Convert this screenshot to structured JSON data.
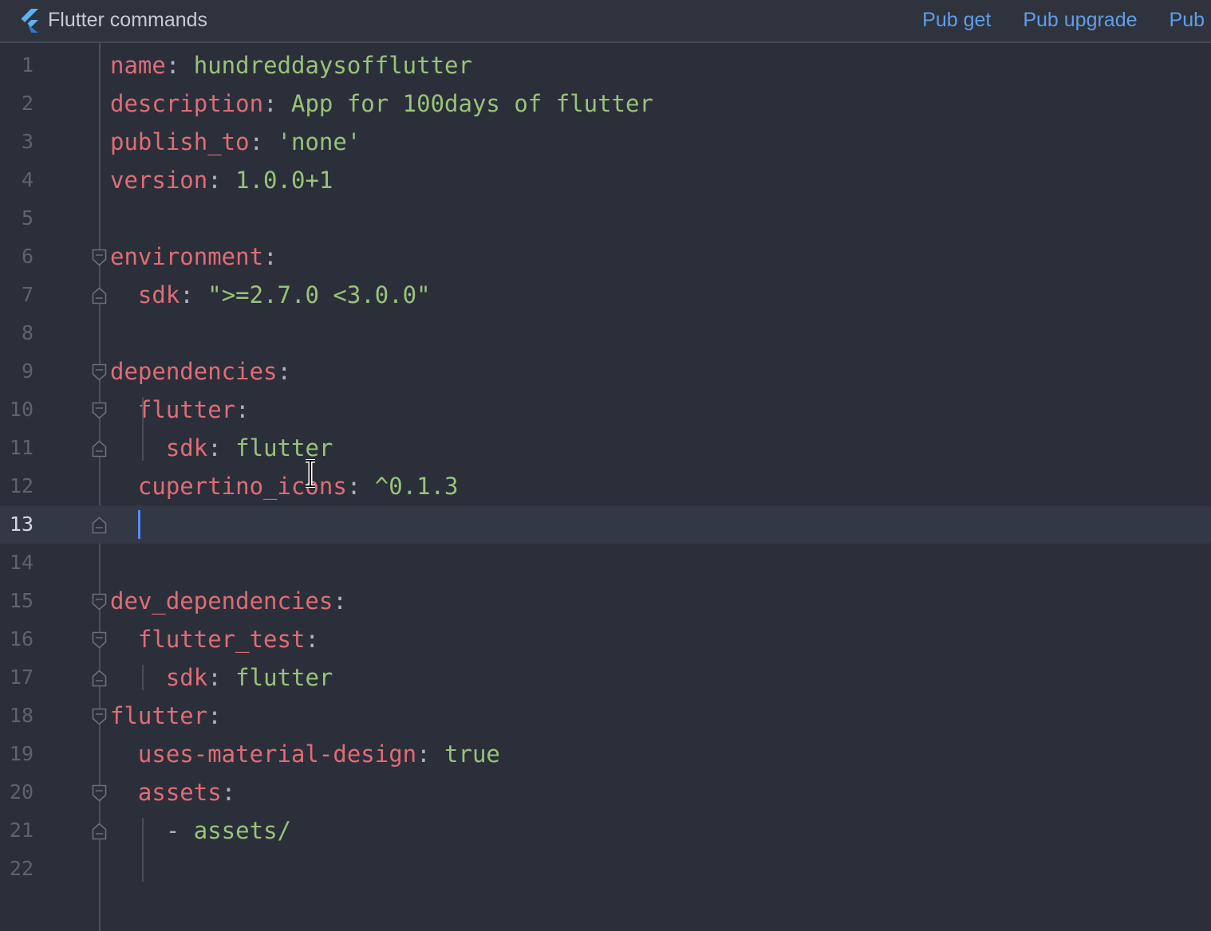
{
  "header": {
    "title": "Flutter commands",
    "actions": [
      "Pub get",
      "Pub upgrade",
      "Pub"
    ]
  },
  "colors": {
    "background": "#2b2f3a",
    "active_line": "#333845",
    "key": "#e06c75",
    "value": "#98c379",
    "punctuation": "#abb2bf",
    "line_number": "#5e636e",
    "link": "#5f9ee8",
    "caret": "#528bff"
  },
  "editor": {
    "active_line": 13,
    "lines": [
      {
        "n": "1",
        "key": "name",
        "sep": ": ",
        "val": "hundreddaysofflutter"
      },
      {
        "n": "2",
        "key": "description",
        "sep": ": ",
        "val": "App for 100days of flutter"
      },
      {
        "n": "3",
        "key": "publish_to",
        "sep": ": ",
        "val": "'none'"
      },
      {
        "n": "4",
        "key": "version",
        "sep": ": ",
        "val": "1.0.0+1"
      },
      {
        "n": "5"
      },
      {
        "n": "6",
        "key": "environment",
        "sep": ":"
      },
      {
        "n": "7",
        "indent": "  ",
        "key": "sdk",
        "sep": ": ",
        "val": "\">=2.7.0 <3.0.0\""
      },
      {
        "n": "8"
      },
      {
        "n": "9",
        "key": "dependencies",
        "sep": ":"
      },
      {
        "n": "10",
        "indent": "  ",
        "key": "flutter",
        "sep": ":"
      },
      {
        "n": "11",
        "indent": "    ",
        "key": "sdk",
        "sep": ": ",
        "val": "flutter"
      },
      {
        "n": "12",
        "indent": "  ",
        "key": "cupertino_icons",
        "sep": ": ",
        "val": "^0.1.3"
      },
      {
        "n": "13"
      },
      {
        "n": "14"
      },
      {
        "n": "15",
        "key": "dev_dependencies",
        "sep": ":"
      },
      {
        "n": "16",
        "indent": "  ",
        "key": "flutter_test",
        "sep": ":"
      },
      {
        "n": "17",
        "indent": "    ",
        "key": "sdk",
        "sep": ": ",
        "val": "flutter"
      },
      {
        "n": "18",
        "key": "flutter",
        "sep": ":"
      },
      {
        "n": "19",
        "indent": "  ",
        "key": "uses-material-design",
        "sep": ": ",
        "val": "true"
      },
      {
        "n": "20",
        "indent": "  ",
        "key": "assets",
        "sep": ":"
      },
      {
        "n": "21",
        "indent": "    ",
        "dash": "- ",
        "val": "assets/"
      },
      {
        "n": "22"
      }
    ]
  }
}
